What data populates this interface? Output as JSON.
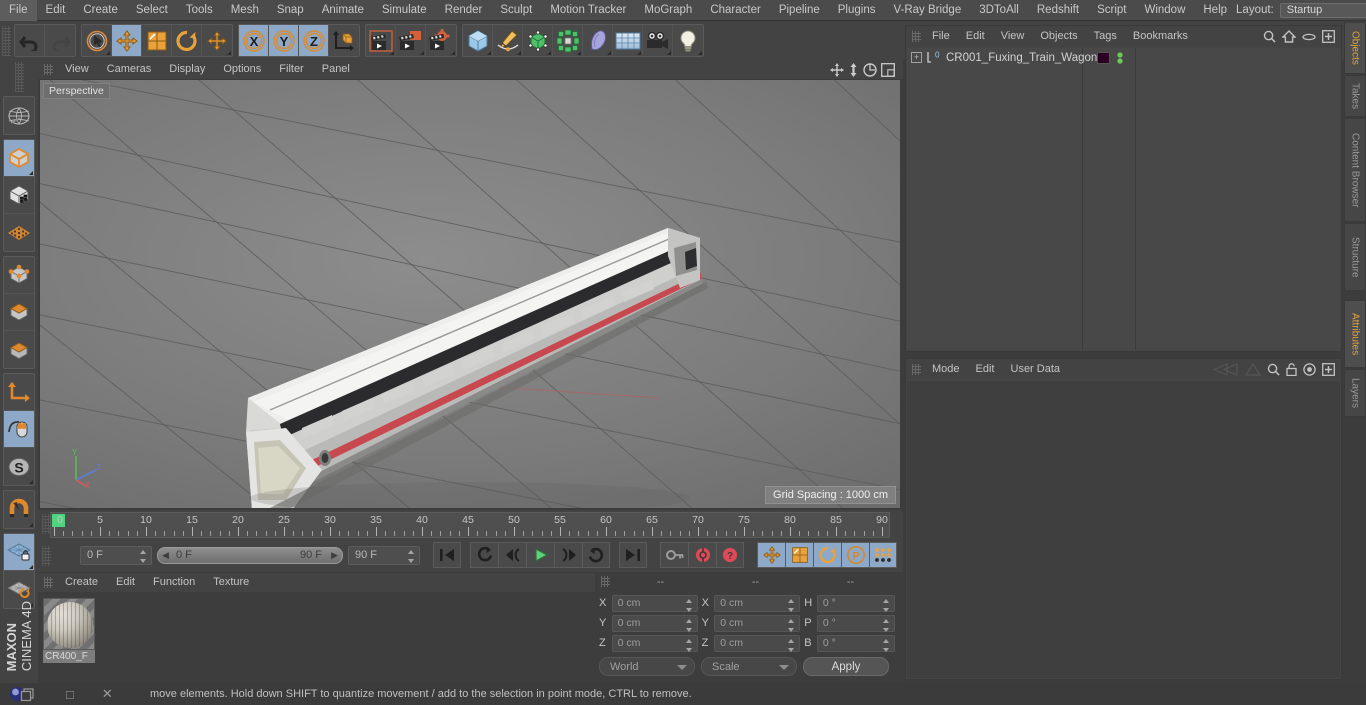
{
  "app": {
    "name": "CINEMA 4D",
    "brand": "MAXON"
  },
  "menubar": {
    "items": [
      "File",
      "Edit",
      "Create",
      "Select",
      "Tools",
      "Mesh",
      "Snap",
      "Animate",
      "Simulate",
      "Render",
      "Sculpt",
      "Motion Tracker",
      "MoGraph",
      "Character",
      "Pipeline",
      "Plugins",
      "V-Ray Bridge",
      "3DToAll",
      "Redshift",
      "Script",
      "Window",
      "Help"
    ],
    "layout_label": "Layout:",
    "layout_value": "Startup",
    "search_icon": "magnifier-icon"
  },
  "toolbar": {
    "groups": [
      {
        "name": "history",
        "buttons": [
          {
            "icon": "undo-icon",
            "label": "Undo",
            "active": false,
            "dim": false
          },
          {
            "icon": "redo-icon",
            "label": "Redo",
            "active": false,
            "dim": true
          }
        ]
      },
      {
        "name": "transform",
        "buttons": [
          {
            "icon": "select-live-icon",
            "label": "Live Selection",
            "active": false,
            "dim": false
          },
          {
            "icon": "move-icon",
            "label": "Move",
            "active": true,
            "dim": false
          },
          {
            "icon": "scale-icon",
            "label": "Scale",
            "active": false,
            "dim": false
          },
          {
            "icon": "rotate-icon",
            "label": "Rotate",
            "active": false,
            "dim": false
          },
          {
            "icon": "move-alt-icon",
            "label": "Move Alt",
            "active": false,
            "dim": false
          }
        ]
      },
      {
        "name": "axis-lock",
        "buttons": [
          {
            "icon": "axis-x-icon",
            "label": "X",
            "active": true,
            "dim": false
          },
          {
            "icon": "axis-y-icon",
            "label": "Y",
            "active": true,
            "dim": false
          },
          {
            "icon": "axis-z-icon",
            "label": "Z",
            "active": true,
            "dim": false
          },
          {
            "icon": "world-coord-icon",
            "label": "World / Object",
            "active": false,
            "dim": false
          }
        ]
      },
      {
        "name": "render",
        "buttons": [
          {
            "icon": "render-view-icon",
            "label": "Render View",
            "active": false,
            "dim": false
          },
          {
            "icon": "render-picture-icon",
            "label": "Render to Picture Viewer",
            "active": false,
            "dim": false
          },
          {
            "icon": "render-settings-icon",
            "label": "Edit Render Settings",
            "active": false,
            "dim": false
          }
        ]
      },
      {
        "name": "create",
        "buttons": [
          {
            "icon": "cube-primitive-icon",
            "label": "Add Cube Object",
            "active": false,
            "dim": false
          },
          {
            "icon": "spline-pen-icon",
            "label": "Add Spline",
            "active": false,
            "dim": false
          },
          {
            "icon": "nurbs-icon",
            "label": "Add Generator",
            "active": false,
            "dim": false
          },
          {
            "icon": "deformer-icon",
            "label": "Add Deformer",
            "active": false,
            "dim": false
          },
          {
            "icon": "environment-icon",
            "label": "Add Environment",
            "active": false,
            "dim": false
          },
          {
            "icon": "floor-icon",
            "label": "Add Floor",
            "active": false,
            "dim": false
          },
          {
            "icon": "camera-icon",
            "label": "Add Camera",
            "active": false,
            "dim": false
          },
          {
            "icon": "light-icon",
            "label": "Add Light",
            "active": false,
            "dim": false
          }
        ]
      }
    ]
  },
  "left_toolbar": {
    "groups": [
      {
        "buttons": [
          {
            "icon": "globe-deform-icon",
            "label": "Make Editable",
            "active": false
          }
        ]
      },
      {
        "buttons": [
          {
            "icon": "model-mode-icon",
            "label": "Model Mode",
            "active": true
          },
          {
            "icon": "texture-mode-icon",
            "label": "Texture Mode",
            "active": false
          },
          {
            "icon": "mesh-points-icon",
            "label": "Points Mode",
            "active": false
          }
        ]
      },
      {
        "buttons": [
          {
            "icon": "points-edit-icon",
            "label": "Points",
            "active": false
          },
          {
            "icon": "edges-edit-icon",
            "label": "Edges",
            "active": false
          },
          {
            "icon": "polygons-edit-icon",
            "label": "Polygons",
            "active": false
          }
        ]
      },
      {
        "buttons": [
          {
            "icon": "axis-modify-icon",
            "label": "Enable Axis Modification",
            "active": false
          },
          {
            "icon": "viewport-solo-icon",
            "label": "Viewport Solo",
            "active": true
          },
          {
            "icon": "soft-selection-icon",
            "label": "Soft Selection",
            "active": true
          }
        ]
      },
      {
        "buttons": [
          {
            "icon": "magnet-icon",
            "label": "Magnet",
            "active": false
          }
        ]
      },
      {
        "buttons": [
          {
            "icon": "workplane-lock-icon",
            "label": "Lock Workplane",
            "active": true
          },
          {
            "icon": "workplane-rotate-icon",
            "label": "Rotate Workplane",
            "active": false
          }
        ]
      }
    ]
  },
  "viewport": {
    "menu": [
      "View",
      "Cameras",
      "Display",
      "Options",
      "Filter",
      "Panel"
    ],
    "corner_icons": [
      "pan-icon",
      "dolly-icon",
      "orbit-icon",
      "maximize-icon"
    ],
    "label": "Perspective",
    "grid_spacing": "Grid Spacing : 1000 cm",
    "axis_labels": {
      "x": "X",
      "y": "Y",
      "z": "Z"
    }
  },
  "timeline": {
    "tick_labels": [
      "0",
      "5",
      "10",
      "15",
      "20",
      "25",
      "30",
      "35",
      "40",
      "45",
      "50",
      "55",
      "60",
      "65",
      "70",
      "75",
      "80",
      "85",
      "90"
    ],
    "current_frame": "0 F",
    "range_start": "0 F",
    "range_end": "90 F",
    "doc_end": "90 F",
    "frame_right": "0 F",
    "transport": [
      {
        "icon": "go-to-start-icon",
        "label": "Go to Start"
      },
      {
        "icon": "play-backwards-loop-icon",
        "label": "Play Backwards"
      },
      {
        "icon": "previous-frame-icon",
        "label": "Previous Frame"
      },
      {
        "icon": "play-forward-icon",
        "label": "Play Forward",
        "accent": "#5ed27a"
      },
      {
        "icon": "next-frame-icon",
        "label": "Next Frame"
      },
      {
        "icon": "play-loop-icon",
        "label": "Loop"
      },
      {
        "icon": "go-to-end-icon",
        "label": "Go to End"
      }
    ],
    "record_group": [
      {
        "icon": "autokey-icon",
        "label": "Autokeying"
      },
      {
        "icon": "record-icon",
        "label": "Record Active Objects",
        "accent": "#e04a58"
      },
      {
        "icon": "keyframe-help-icon",
        "label": "Keyframe Selection",
        "accent": "#e04a58"
      }
    ],
    "key_group": [
      {
        "icon": "key-position-icon",
        "label": "Position",
        "active": true
      },
      {
        "icon": "key-scale-icon",
        "label": "Scale",
        "active": true
      },
      {
        "icon": "key-rotation-icon",
        "label": "Rotation",
        "active": true
      },
      {
        "icon": "key-param-icon",
        "label": "Parameter",
        "active": true
      },
      {
        "icon": "key-pla-icon",
        "label": "Point Level Animation",
        "active": true
      }
    ],
    "timeline_toggle": {
      "icon": "timeline-icon",
      "label": "Timeline",
      "active": true
    }
  },
  "material_manager": {
    "menu": [
      "Create",
      "Edit",
      "Function",
      "Texture"
    ],
    "materials": [
      {
        "name": "CR400_F",
        "thumb": "material-sphere-icon"
      }
    ]
  },
  "coordinates": {
    "headers": [
      "--",
      "--",
      "--"
    ],
    "rows": [
      {
        "pos_label": "X",
        "pos_value": "0 cm",
        "size_label": "X",
        "size_value": "0 cm",
        "rot_label": "H",
        "rot_value": "0 °"
      },
      {
        "pos_label": "Y",
        "pos_value": "0 cm",
        "size_label": "Y",
        "size_value": "0 cm",
        "rot_label": "P",
        "rot_value": "0 °"
      },
      {
        "pos_label": "Z",
        "pos_value": "0 cm",
        "size_label": "Z",
        "size_value": "0 cm",
        "rot_label": "B",
        "rot_value": "0 °"
      }
    ],
    "system": "World",
    "mode": "Scale",
    "apply": "Apply"
  },
  "object_manager": {
    "menu": [
      "File",
      "Edit",
      "View",
      "Objects",
      "Tags",
      "Bookmarks"
    ],
    "icons": [
      "search-icon",
      "home-icon",
      "ellipse-icon",
      "add-layer-icon"
    ],
    "objects": [
      {
        "name": "CR001_Fuxing_Train_Wagon",
        "expandable": true,
        "layer_color": "#2b0020",
        "visibility_top": "#6fca5a",
        "visibility_bottom": "#6fca5a"
      }
    ]
  },
  "attribute_manager": {
    "menu": [
      "Mode",
      "Edit",
      "User Data"
    ],
    "icons": [
      "bookmark-back-icon",
      "bookmark-up-icon",
      "search-icon",
      "lock-icon",
      "target-icon",
      "add-icon"
    ]
  },
  "right_tabs": {
    "top_group": [
      {
        "label": "Objects",
        "active": true
      },
      {
        "label": "Takes",
        "active": false
      },
      {
        "label": "Content Browser",
        "active": false
      },
      {
        "label": "Structure",
        "active": false
      }
    ],
    "bottom_group": [
      {
        "label": "Attributes",
        "active": true
      },
      {
        "label": "Layers",
        "active": false
      }
    ]
  },
  "status_bar": {
    "message": "move elements. Hold down SHIFT to quantize movement / add to the selection in point mode, CTRL to remove.",
    "taskbar": [
      "c4d-app-icon",
      "restore-icon",
      "minimize-icon",
      "close-icon"
    ]
  },
  "colors": {
    "accent_orange": "#e2a33c",
    "active_blue": "#8ea8c8",
    "panel_bg": "#434343",
    "viewport_bg": "#7b7b7b",
    "green_marker": "#4ed37f",
    "record_red": "#e04a58"
  }
}
